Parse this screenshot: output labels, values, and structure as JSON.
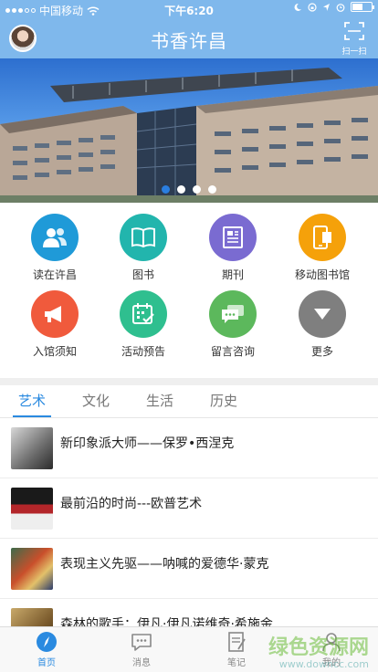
{
  "status_bar": {
    "carrier": "中国移动",
    "time": "下午6:20"
  },
  "header": {
    "title": "书香许昌",
    "scan_label": "扫一扫"
  },
  "banner": {
    "slides_total": 4,
    "active_index": 0
  },
  "menu": {
    "items": [
      {
        "label": "读在许昌",
        "icon": "people-icon",
        "color": "#1f9ad8"
      },
      {
        "label": "图书",
        "icon": "book-icon",
        "color": "#22b5ad"
      },
      {
        "label": "期刊",
        "icon": "periodical-icon",
        "color": "#7a6bd1"
      },
      {
        "label": "移动图书馆",
        "icon": "mobile-library-icon",
        "color": "#f5a10a"
      },
      {
        "label": "入馆须知",
        "icon": "megaphone-icon",
        "color": "#f05a3c"
      },
      {
        "label": "活动预告",
        "icon": "calendar-icon",
        "color": "#2fbf8f"
      },
      {
        "label": "留言咨询",
        "icon": "chat-icon",
        "color": "#5cb85c"
      },
      {
        "label": "更多",
        "icon": "chevron-down-icon",
        "color": "#7f7f7f"
      }
    ]
  },
  "tabs": [
    {
      "label": "艺术",
      "active": true
    },
    {
      "label": "文化",
      "active": false
    },
    {
      "label": "生活",
      "active": false
    },
    {
      "label": "历史",
      "active": false
    }
  ],
  "articles": [
    {
      "title": "新印象派大师——保罗•西涅克"
    },
    {
      "title": "最前沿的时尚---欧普艺术"
    },
    {
      "title": "表现主义先驱——呐喊的爱德华·蒙克"
    },
    {
      "title": "森林的歌手：伊凡·伊凡诺维奇·希施金"
    }
  ],
  "tabbar": {
    "items": [
      {
        "label": "首页",
        "icon": "compass-icon",
        "active": true
      },
      {
        "label": "消息",
        "icon": "message-icon",
        "active": false
      },
      {
        "label": "笔记",
        "icon": "note-icon",
        "active": false
      },
      {
        "label": "我的",
        "icon": "user-icon",
        "active": false
      }
    ]
  },
  "watermark": {
    "text": "绿色资源网",
    "url": "www.downcc.com"
  },
  "colors": {
    "header_bg": "#7fb8ec",
    "accent": "#2a8ae0"
  }
}
